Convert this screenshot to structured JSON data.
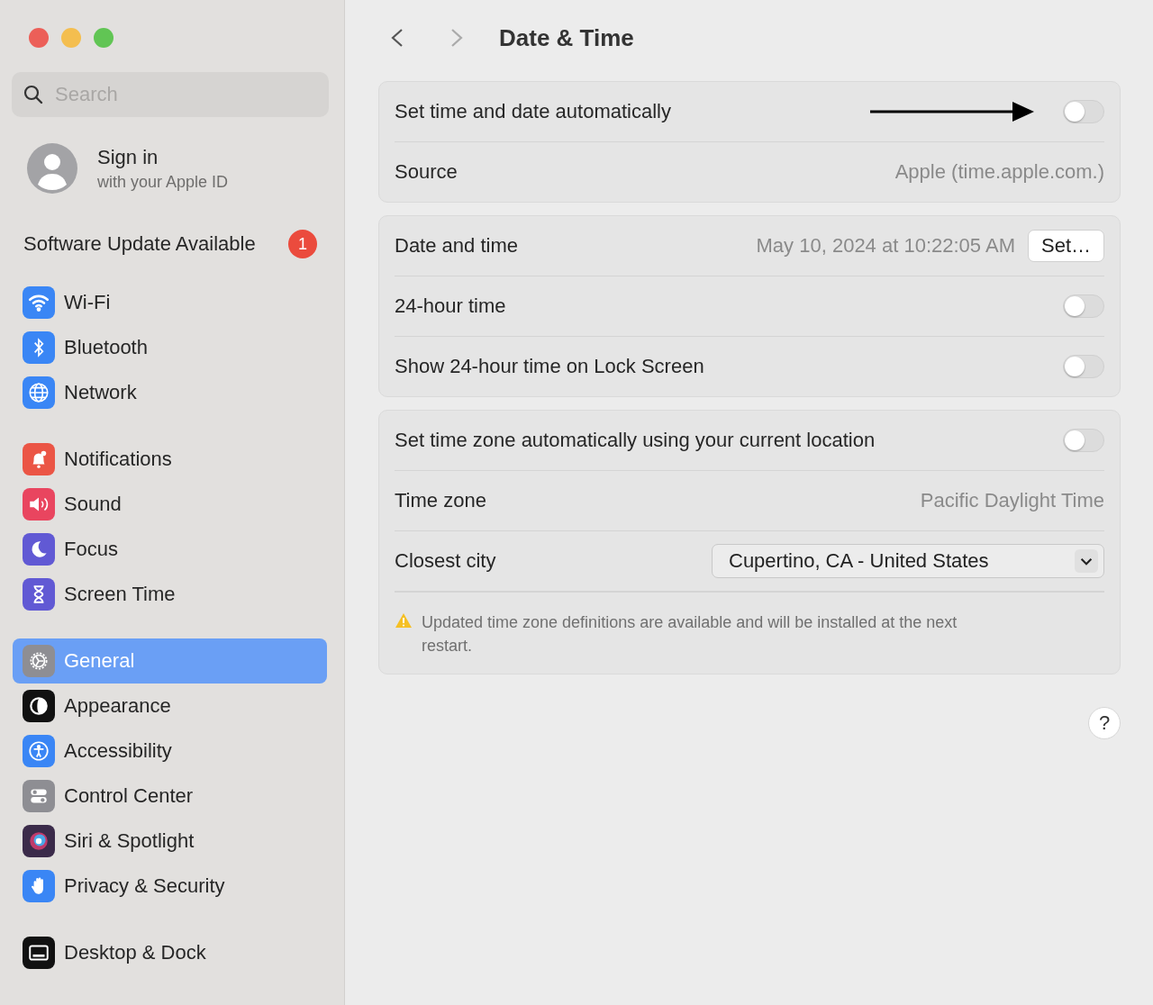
{
  "window": {
    "traffic_lights": [
      {
        "color": "#ec5f58"
      },
      {
        "color": "#f4be4f"
      },
      {
        "color": "#61c554"
      }
    ]
  },
  "sidebar": {
    "search": {
      "placeholder": "Search"
    },
    "account": {
      "title": "Sign in",
      "subtitle": "with your Apple ID"
    },
    "update": {
      "label": "Software Update Available",
      "badge": "1"
    },
    "groups": [
      [
        {
          "kind": "wifi",
          "label": "Wi-Fi",
          "selected": false
        },
        {
          "kind": "bluetooth",
          "label": "Bluetooth",
          "selected": false
        },
        {
          "kind": "network",
          "label": "Network",
          "selected": false
        }
      ],
      [
        {
          "kind": "notifications",
          "label": "Notifications",
          "selected": false
        },
        {
          "kind": "sound",
          "label": "Sound",
          "selected": false
        },
        {
          "kind": "focus",
          "label": "Focus",
          "selected": false
        },
        {
          "kind": "screentime",
          "label": "Screen Time",
          "selected": false
        }
      ],
      [
        {
          "kind": "general",
          "label": "General",
          "selected": true
        },
        {
          "kind": "appearance",
          "label": "Appearance",
          "selected": false
        },
        {
          "kind": "accessibility",
          "label": "Accessibility",
          "selected": false
        },
        {
          "kind": "controlcenter",
          "label": "Control Center",
          "selected": false
        },
        {
          "kind": "siri",
          "label": "Siri & Spotlight",
          "selected": false
        },
        {
          "kind": "privacy",
          "label": "Privacy & Security",
          "selected": false
        }
      ],
      [
        {
          "kind": "desktop",
          "label": "Desktop & Dock",
          "selected": false
        }
      ]
    ]
  },
  "main": {
    "title": "Date & Time",
    "sections": [
      [
        {
          "kind": "toggle",
          "label": "Set time and date automatically",
          "on": false,
          "annotated": true
        },
        {
          "kind": "value",
          "label": "Source",
          "value": "Apple (time.apple.com.)"
        }
      ],
      [
        {
          "kind": "datetime",
          "label": "Date and time",
          "value": "May 10, 2024 at 10:22:05 AM",
          "button": "Set…"
        },
        {
          "kind": "toggle",
          "label": "24-hour time",
          "on": false,
          "annotated": false
        },
        {
          "kind": "toggle",
          "label": "Show 24-hour time on Lock Screen",
          "on": false,
          "annotated": false
        }
      ],
      [
        {
          "kind": "toggle",
          "label": "Set time zone automatically using your current location",
          "on": false,
          "annotated": false
        },
        {
          "kind": "value",
          "label": "Time zone",
          "value": "Pacific Daylight Time"
        },
        {
          "kind": "select",
          "label": "Closest city",
          "value": "Cupertino, CA - United States"
        },
        {
          "kind": "note",
          "text": "Updated time zone definitions are available and will be installed at the next restart."
        }
      ]
    ],
    "help": "?"
  }
}
